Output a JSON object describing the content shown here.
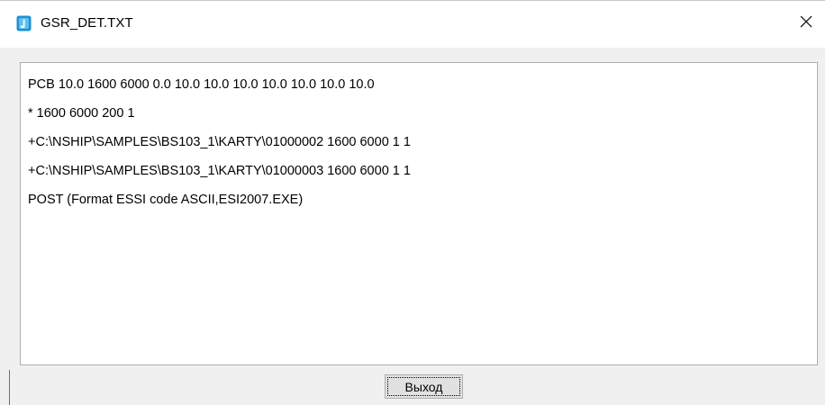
{
  "window": {
    "title": "GSR_DET.TXT",
    "app_icon": "app-icon",
    "close_icon": "close-icon"
  },
  "content": {
    "lines": [
      "PCB 10.0 1600 6000 0.0 10.0 10.0 10.0 10.0 10.0 10.0 10.0",
      "* 1600 6000 200 1",
      "+C:\\NSHIP\\SAMPLES\\BS103_1\\KARTY\\01000002 1600 6000 1 1",
      "+C:\\NSHIP\\SAMPLES\\BS103_1\\KARTY\\01000003 1600 6000 1 1",
      "POST (Format ESSI code ASCII,ESI2007.EXE)"
    ]
  },
  "buttons": {
    "exit_label": "Выход"
  },
  "colors": {
    "titlebar_bg": "#ffffff",
    "client_bg": "#f0f0f0",
    "icon_blue": "#1e90d6",
    "button_bg": "#e1e1e1"
  }
}
